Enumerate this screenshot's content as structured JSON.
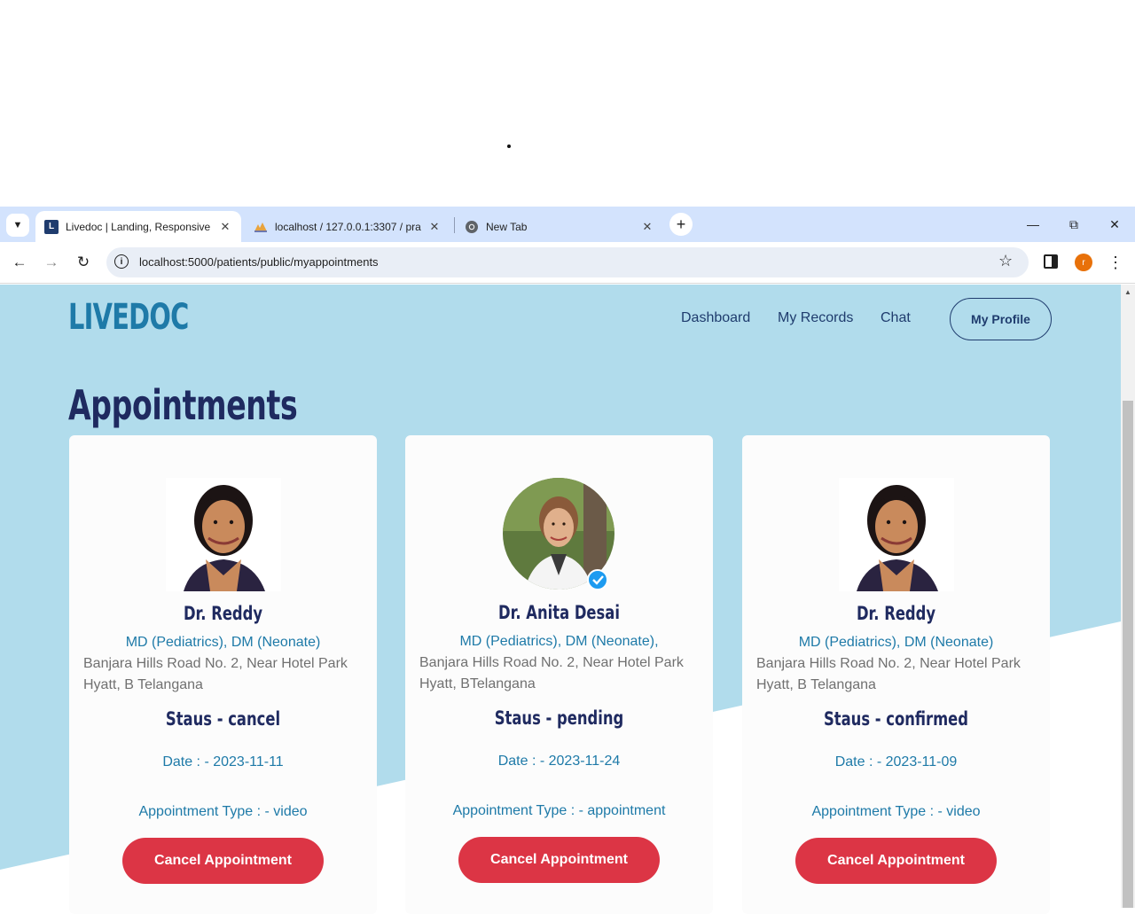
{
  "browser": {
    "tabs": [
      {
        "title": "Livedoc | Landing, Responsive",
        "favicon": "L"
      },
      {
        "title": "localhost / 127.0.0.1:3307 / pra"
      },
      {
        "title": "New Tab"
      }
    ],
    "url": "localhost:5000/patients/public/myappointments",
    "profile_initial": "r"
  },
  "header": {
    "logo": "LIVEDOC",
    "nav": [
      "Dashboard",
      "My Records",
      "Chat"
    ],
    "profile_button": "My Profile"
  },
  "page": {
    "title": "Appointments"
  },
  "appointments": [
    {
      "doctor": "Dr. Reddy",
      "qualifications": "MD (Pediatrics), DM (Neonate)",
      "address": "Banjara Hills Road No. 2, Near Hotel Park Hyatt, B Telangana",
      "status": "Staus - cancel",
      "date": "Date : - 2023-11-11",
      "type": "Appointment Type : - video",
      "button": "Cancel Appointment"
    },
    {
      "doctor": "Dr. Anita Desai",
      "qualifications": "MD (Pediatrics), DM (Neonate),",
      "address": "Banjara Hills Road No. 2, Near Hotel Park Hyatt, BTelangana",
      "status": "Staus - pending",
      "date": "Date : - 2023-11-24",
      "type": "Appointment Type : - appointment",
      "button": "Cancel Appointment"
    },
    {
      "doctor": "Dr. Reddy",
      "qualifications": "MD (Pediatrics), DM (Neonate)",
      "address": "Banjara Hills Road No. 2, Near Hotel Park Hyatt, B Telangana",
      "status": "Staus - confirmed",
      "date": "Date : - 2023-11-09",
      "type": "Appointment Type : - video",
      "button": "Cancel Appointment"
    }
  ],
  "colors": {
    "page_bg": "#b1dcec",
    "brand": "#1e7aa8",
    "heading": "#1f2a60",
    "danger": "#dc3545"
  }
}
